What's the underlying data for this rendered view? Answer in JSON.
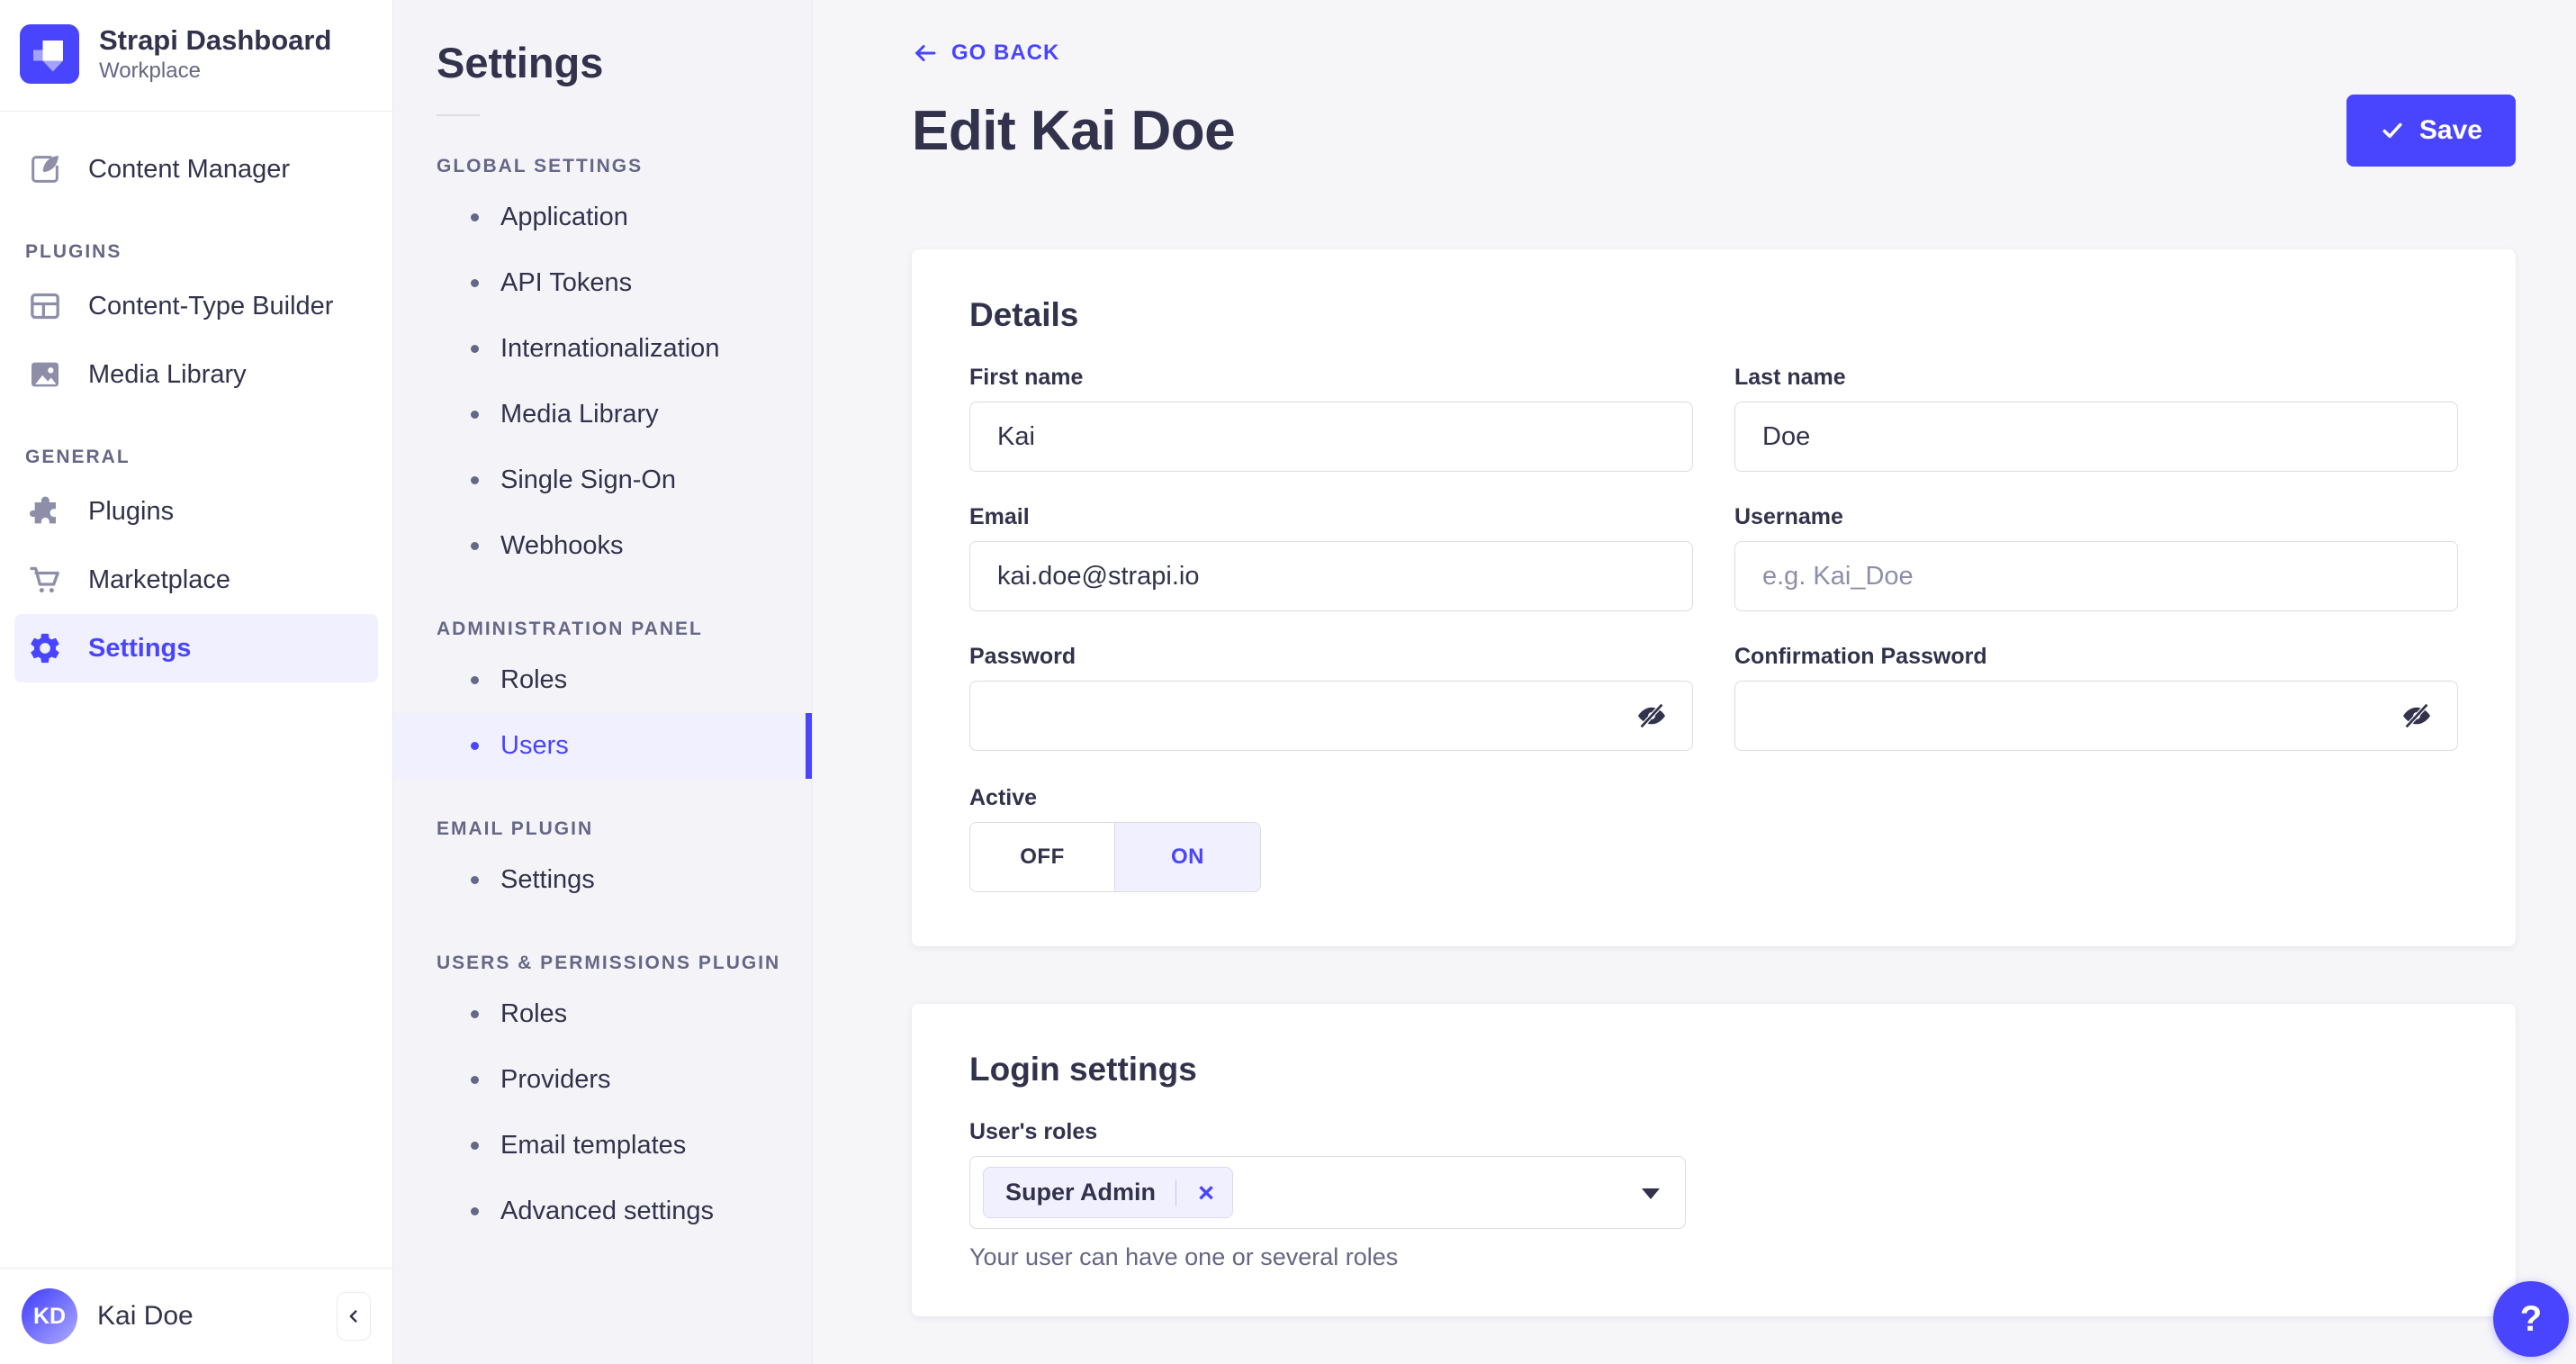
{
  "app": {
    "title": "Strapi Dashboard",
    "workspace": "Workplace"
  },
  "sidebar": {
    "content_manager": "Content Manager",
    "sections": [
      {
        "title": "PLUGINS",
        "items": [
          {
            "label": "Content-Type Builder",
            "icon": "layout-grid-icon"
          },
          {
            "label": "Media Library",
            "icon": "image-icon"
          }
        ]
      },
      {
        "title": "GENERAL",
        "items": [
          {
            "label": "Plugins",
            "icon": "puzzle-icon"
          },
          {
            "label": "Marketplace",
            "icon": "cart-icon"
          },
          {
            "label": "Settings",
            "icon": "gear-icon",
            "active": true
          }
        ]
      }
    ],
    "user": {
      "initials": "KD",
      "name": "Kai Doe"
    }
  },
  "subnav": {
    "title": "Settings",
    "sections": [
      {
        "title": "GLOBAL SETTINGS",
        "items": [
          "Application",
          "API Tokens",
          "Internationalization",
          "Media Library",
          "Single Sign-On",
          "Webhooks"
        ]
      },
      {
        "title": "ADMINISTRATION PANEL",
        "items": [
          "Roles",
          "Users"
        ],
        "active_item": "Users"
      },
      {
        "title": "EMAIL PLUGIN",
        "items": [
          "Settings"
        ]
      },
      {
        "title": "USERS & PERMISSIONS PLUGIN",
        "items": [
          "Roles",
          "Providers",
          "Email templates",
          "Advanced settings"
        ]
      }
    ]
  },
  "header": {
    "go_back": "GO BACK",
    "title": "Edit Kai Doe",
    "save": "Save"
  },
  "details": {
    "heading": "Details",
    "fields": {
      "first_name": {
        "label": "First name",
        "value": "Kai"
      },
      "last_name": {
        "label": "Last name",
        "value": "Doe"
      },
      "email": {
        "label": "Email",
        "value": "kai.doe@strapi.io"
      },
      "username": {
        "label": "Username",
        "placeholder": "e.g. Kai_Doe",
        "value": ""
      },
      "password": {
        "label": "Password",
        "value": ""
      },
      "confirm_password": {
        "label": "Confirmation Password",
        "value": ""
      }
    },
    "active": {
      "label": "Active",
      "off": "OFF",
      "on": "ON",
      "value": "ON"
    }
  },
  "login": {
    "heading": "Login settings",
    "roles": {
      "label": "User's roles",
      "selected": "Super Admin",
      "remove_icon": "×",
      "hint": "Your user can have one or several roles"
    }
  },
  "help": {
    "label": "?"
  },
  "colors": {
    "accent": "#4945ff",
    "accent_light": "#f0f0ff",
    "text": "#32324d",
    "muted": "#666687",
    "border": "#dcdce4",
    "divider": "#eaeaef",
    "background": "#f6f6f9"
  }
}
